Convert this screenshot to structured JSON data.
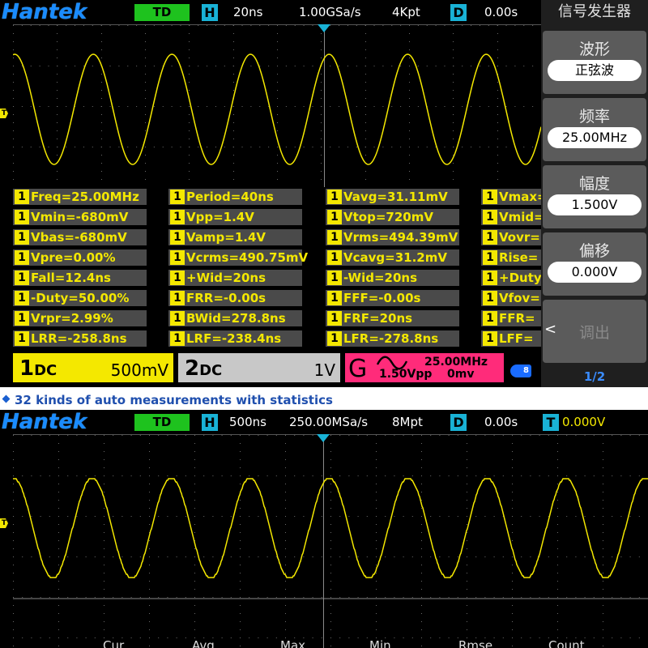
{
  "scope1": {
    "brand": "Hantek",
    "mode": "TD",
    "timebase_badge": "H",
    "timebase": "20ns",
    "sample_rate": "1.00GSa/s",
    "memory_depth": "4Kpt",
    "delay_badge": "D",
    "delay": "0.00s",
    "trigger_marker": "T",
    "measurement_channel": "1",
    "measurements": [
      [
        "Freq=25.00MHz",
        "Period=40ns",
        "Vavg=31.11mV",
        "Vmax="
      ],
      [
        "Vmin=-680mV",
        "Vpp=1.4V",
        "Vtop=720mV",
        "Vmid="
      ],
      [
        "Vbas=-680mV",
        "Vamp=1.4V",
        "Vrms=494.39mV",
        "Vovr="
      ],
      [
        "Vpre=0.00%",
        "Vcrms=490.75mV",
        "Vcavg=31.2mV",
        "Rise="
      ],
      [
        "Fall=12.4ns",
        "+Wid=20ns",
        "-Wid=20ns",
        "+Duty"
      ],
      [
        "-Duty=50.00%",
        "FRR=-0.00s",
        "FFF=-0.00s",
        "Vfov="
      ],
      [
        "Vrpr=2.99%",
        "BWid=278.8ns",
        "FRF=20ns",
        "FFR="
      ],
      [
        "LRR=-258.8ns",
        "LRF=-238.4ns",
        "LFR=-278.8ns",
        "LFF="
      ]
    ],
    "ch1": {
      "name": "1",
      "coupling": "DC",
      "scale": "500mV"
    },
    "ch2": {
      "name": "2",
      "coupling": "DC",
      "scale": "1V"
    },
    "generator": {
      "label": "G",
      "frequency": "25.00MHz",
      "amplitude": "1.50Vpp",
      "offset": "0mv"
    },
    "usb_label": "8"
  },
  "side_menu": {
    "title": "信号发生器",
    "items": [
      {
        "label": "波形",
        "value": "正弦波"
      },
      {
        "label": "频率",
        "value": "25.00MHz"
      },
      {
        "label": "幅度",
        "value": "1.500V"
      },
      {
        "label": "偏移",
        "value": "0.000V"
      },
      {
        "label": "调出"
      }
    ],
    "page": "1/2"
  },
  "banner": {
    "text": "32 kinds of auto measurements with statistics"
  },
  "scope2": {
    "brand": "Hantek",
    "mode": "TD",
    "timebase_badge": "H",
    "timebase": "500ns",
    "sample_rate": "250.00MSa/s",
    "memory_depth": "8Mpt",
    "delay_badge": "D",
    "delay": "0.00s",
    "trigger_badge": "T",
    "trigger_level": "0.000V",
    "trigger_marker": "T",
    "stats_headers": [
      "Cur",
      "Avg",
      "Max",
      "Min",
      "Rmse",
      "Count"
    ]
  },
  "colors": {
    "trace": "#f4e800",
    "grid": "#6a6a6a",
    "accent": "#19b2d6",
    "brand": "#1a8cff"
  }
}
